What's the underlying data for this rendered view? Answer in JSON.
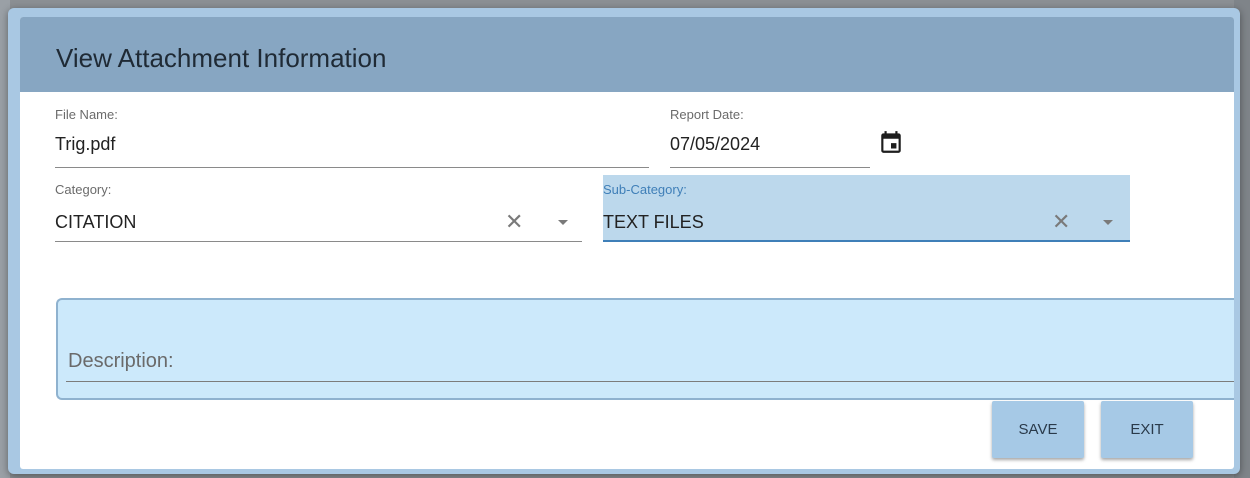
{
  "dialog": {
    "title": "View Attachment Information"
  },
  "fields": {
    "file_name": {
      "label": "File Name:",
      "value": "Trig.pdf"
    },
    "report_date": {
      "label": "Report Date:",
      "value": "07/05/2024"
    },
    "category": {
      "label": "Category:",
      "value": "CITATION"
    },
    "sub_category": {
      "label": "Sub-Category:",
      "value": "TEXT FILES"
    },
    "description": {
      "label": "Description:",
      "value": ""
    }
  },
  "buttons": {
    "save": "SAVE",
    "exit": "EXIT"
  },
  "icons": {
    "clear": "close-icon",
    "dropdown": "caret-down-icon",
    "calendar": "calendar-icon"
  },
  "colors": {
    "header": "#87a6c2",
    "highlight": "#bcd8ec",
    "description_bg": "#cce9fb",
    "button_bg": "#a6c9e6",
    "accent": "#3f7fb8"
  }
}
